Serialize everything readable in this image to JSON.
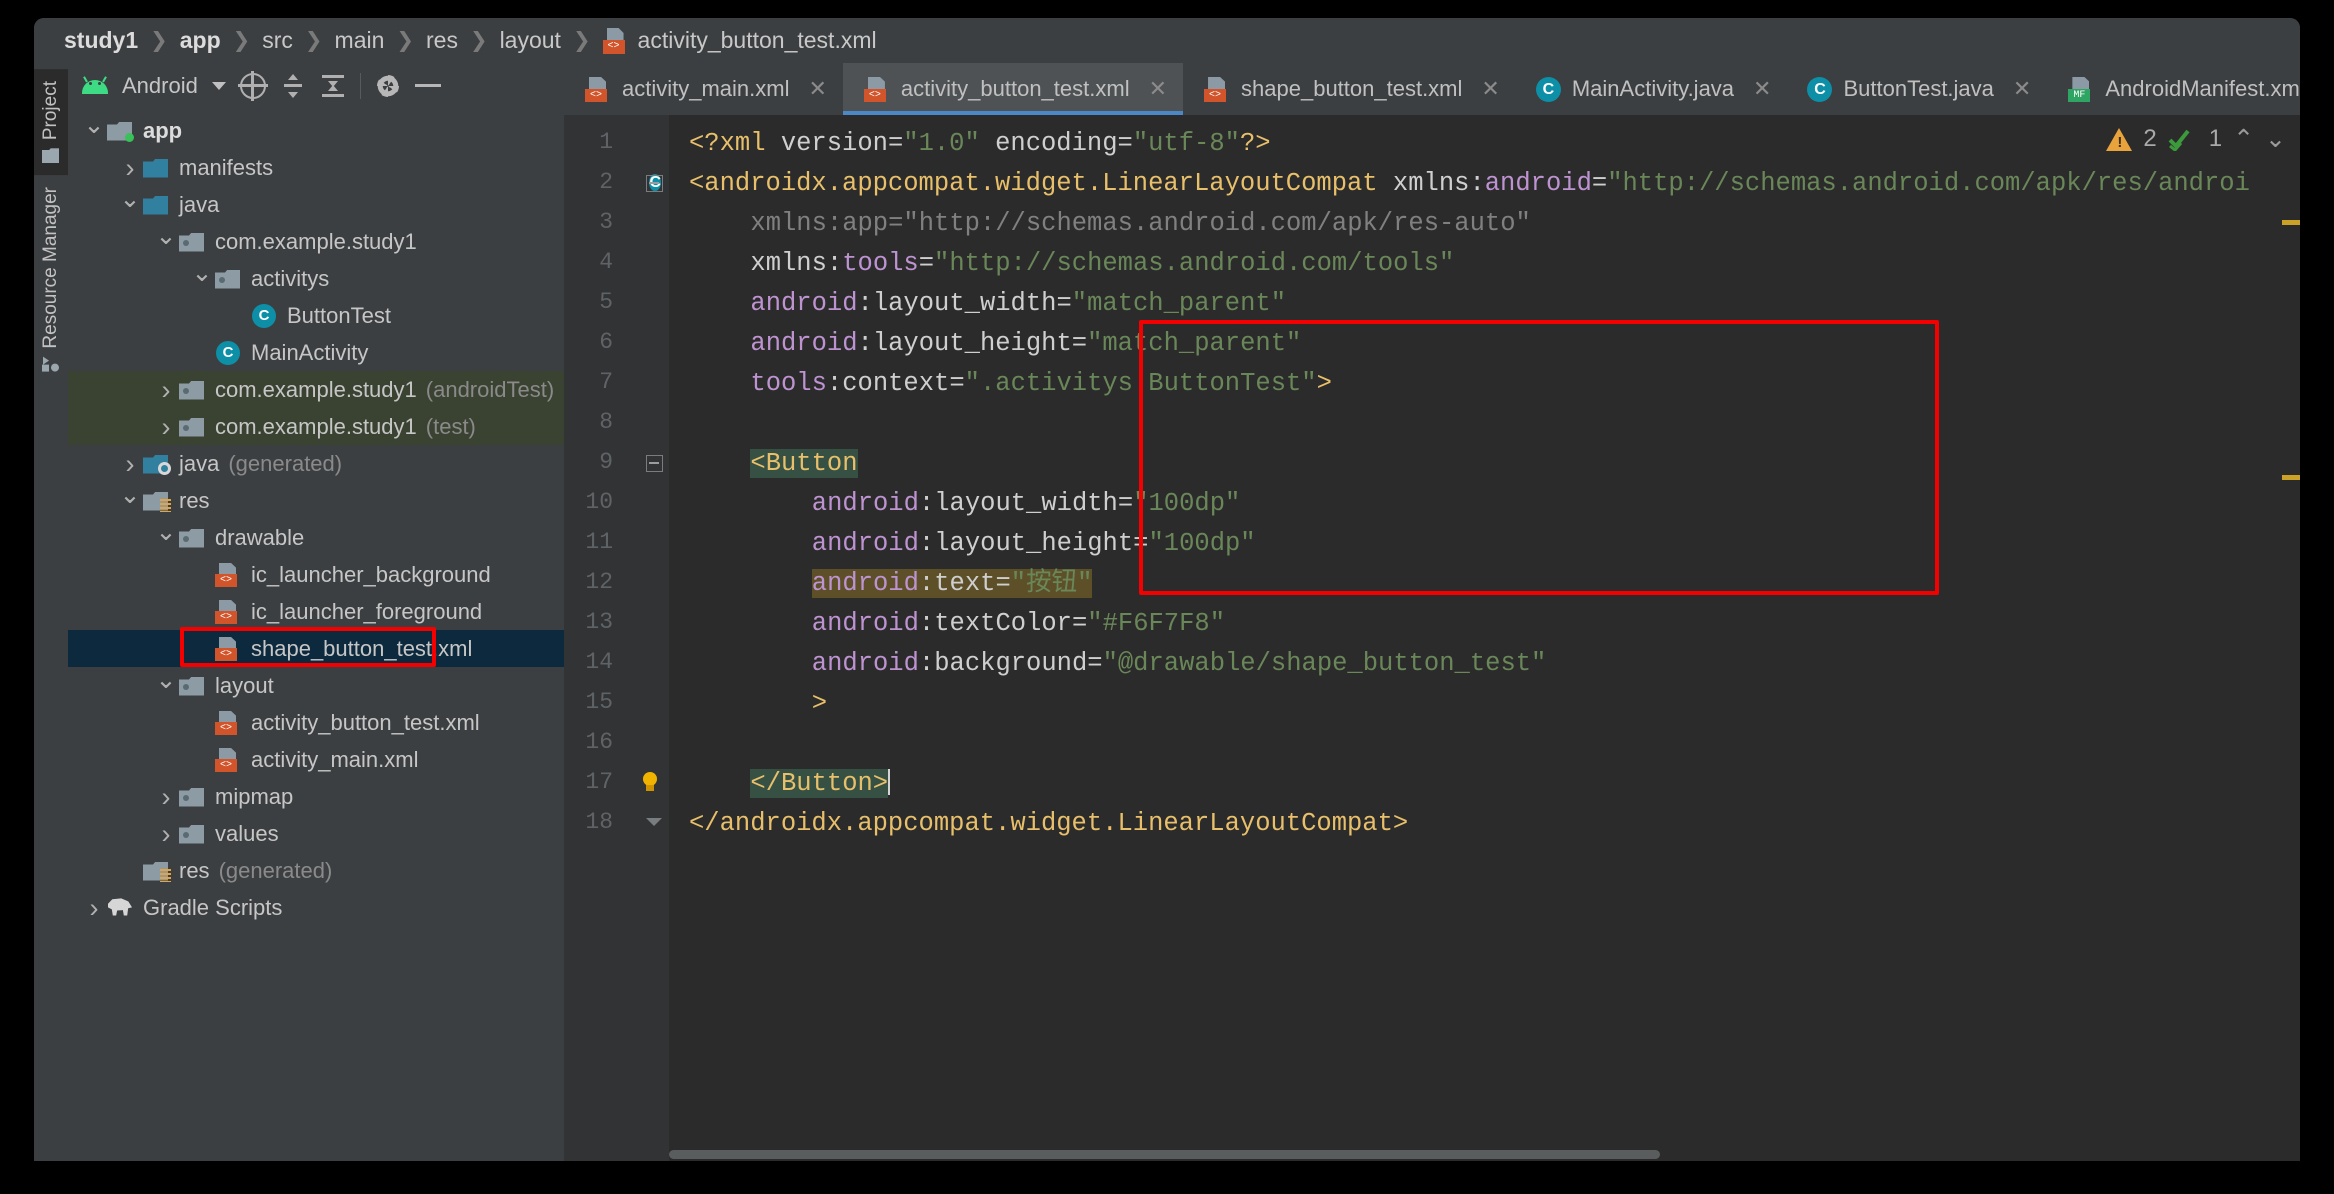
{
  "breadcrumb": {
    "items": [
      "study1",
      "app",
      "src",
      "main",
      "res",
      "layout"
    ],
    "file": "activity_button_test.xml"
  },
  "rail": {
    "project_label": "Project",
    "resource_manager_label": "Resource Manager"
  },
  "project_panel": {
    "title": "Android",
    "toolbar": [
      "select-opened-file-icon",
      "expand-all-icon",
      "collapse-all-icon",
      "settings-icon",
      "hide-icon"
    ],
    "tree": [
      {
        "label": "app",
        "depth": 0,
        "arrow": "down",
        "icon": "folder-module",
        "bold": true
      },
      {
        "label": "manifests",
        "depth": 1,
        "arrow": "right",
        "icon": "folder-blue"
      },
      {
        "label": "java",
        "depth": 1,
        "arrow": "down",
        "icon": "folder-blue"
      },
      {
        "label": "com.example.study1",
        "depth": 2,
        "arrow": "down",
        "icon": "folder-package"
      },
      {
        "label": "activitys",
        "depth": 3,
        "arrow": "down",
        "icon": "folder-package"
      },
      {
        "label": "ButtonTest",
        "depth": 4,
        "arrow": "none",
        "icon": "java-class"
      },
      {
        "label": "MainActivity",
        "depth": 3,
        "arrow": "none",
        "icon": "java-class"
      },
      {
        "label": "com.example.study1",
        "suffix": "(androidTest)",
        "depth": 2,
        "arrow": "right",
        "icon": "folder-package",
        "highlight": "green"
      },
      {
        "label": "com.example.study1",
        "suffix": "(test)",
        "depth": 2,
        "arrow": "right",
        "icon": "folder-package",
        "highlight": "green"
      },
      {
        "label": "java",
        "suffix": "(generated)",
        "depth": 1,
        "arrow": "right",
        "icon": "folder-generated"
      },
      {
        "label": "res",
        "depth": 1,
        "arrow": "down",
        "icon": "folder-res"
      },
      {
        "label": "drawable",
        "depth": 2,
        "arrow": "down",
        "icon": "folder-package"
      },
      {
        "label": "ic_launcher_background",
        "depth": 3,
        "arrow": "none",
        "icon": "xml-file"
      },
      {
        "label": "ic_launcher_foreground",
        "depth": 3,
        "arrow": "none",
        "icon": "xml-file"
      },
      {
        "label": "shape_button_test.xml",
        "depth": 3,
        "arrow": "none",
        "icon": "xml-file",
        "highlight": "blue",
        "annotated": true
      },
      {
        "label": "layout",
        "depth": 2,
        "arrow": "down",
        "icon": "folder-package"
      },
      {
        "label": "activity_button_test.xml",
        "depth": 3,
        "arrow": "none",
        "icon": "xml-file"
      },
      {
        "label": "activity_main.xml",
        "depth": 3,
        "arrow": "none",
        "icon": "xml-file"
      },
      {
        "label": "mipmap",
        "depth": 2,
        "arrow": "right",
        "icon": "folder-package"
      },
      {
        "label": "values",
        "depth": 2,
        "arrow": "right",
        "icon": "folder-package"
      },
      {
        "label": "res",
        "suffix": "(generated)",
        "depth": 1,
        "arrow": "none",
        "icon": "folder-res"
      },
      {
        "label": "Gradle Scripts",
        "depth": 0,
        "arrow": "right-small",
        "icon": "gradle"
      }
    ]
  },
  "editor_tabs": [
    {
      "label": "activity_main.xml",
      "icon": "xml-file",
      "active": false,
      "closable": true
    },
    {
      "label": "activity_button_test.xml",
      "icon": "xml-file",
      "active": true,
      "closable": true
    },
    {
      "label": "shape_button_test.xml",
      "icon": "xml-file",
      "active": false,
      "closable": true
    },
    {
      "label": "MainActivity.java",
      "icon": "java-class",
      "active": false,
      "closable": true
    },
    {
      "label": "ButtonTest.java",
      "icon": "java-class",
      "active": false,
      "closable": true
    },
    {
      "label": "AndroidManifest.xml",
      "icon": "manifest-file",
      "active": false,
      "closable": false
    }
  ],
  "inspections": {
    "warning_count": "2",
    "check_count": "1",
    "prev_label": "^",
    "next_label": "⌄"
  },
  "code": {
    "lines": [
      {
        "n": "1",
        "segments": [
          {
            "t": "<?xml ",
            "c": "k-tag"
          },
          {
            "t": "version",
            "c": "k-white"
          },
          {
            "t": "=",
            "c": "k-white"
          },
          {
            "t": "\"1.0\"",
            "c": "k-str"
          },
          {
            "t": " encoding",
            "c": "k-white"
          },
          {
            "t": "=",
            "c": "k-white"
          },
          {
            "t": "\"utf-8\"",
            "c": "k-str"
          },
          {
            "t": "?>",
            "c": "k-tag"
          }
        ]
      },
      {
        "n": "2",
        "gmark": "java-class",
        "fold": "start",
        "segments": [
          {
            "t": "<androidx.appcompat.widget.LinearLayoutCompat ",
            "c": "k-tag"
          },
          {
            "t": "xmlns",
            "c": "k-white"
          },
          {
            "t": ":",
            "c": "k-white"
          },
          {
            "t": "android",
            "c": "k-attr"
          },
          {
            "t": "=",
            "c": "k-white"
          },
          {
            "t": "\"http://schemas.android.com/apk/res/androi",
            "c": "k-str"
          }
        ]
      },
      {
        "n": "3",
        "indent": 4,
        "segments": [
          {
            "t": "xmlns:app=\"http://schemas.android.com/apk/res-auto\"",
            "c": "k-dim"
          }
        ]
      },
      {
        "n": "4",
        "indent": 4,
        "segments": [
          {
            "t": "xmlns",
            "c": "k-white"
          },
          {
            "t": ":",
            "c": "k-white"
          },
          {
            "t": "tools",
            "c": "k-attr"
          },
          {
            "t": "=",
            "c": "k-white"
          },
          {
            "t": "\"http://schemas.android.com/tools\"",
            "c": "k-str"
          }
        ]
      },
      {
        "n": "5",
        "indent": 4,
        "segments": [
          {
            "t": "android",
            "c": "k-attr"
          },
          {
            "t": ":",
            "c": "k-white"
          },
          {
            "t": "layout_width",
            "c": "k-white"
          },
          {
            "t": "=",
            "c": "k-white"
          },
          {
            "t": "\"match_parent\"",
            "c": "k-str"
          }
        ]
      },
      {
        "n": "6",
        "indent": 4,
        "segments": [
          {
            "t": "android",
            "c": "k-attr"
          },
          {
            "t": ":",
            "c": "k-white"
          },
          {
            "t": "layout_height",
            "c": "k-white"
          },
          {
            "t": "=",
            "c": "k-white"
          },
          {
            "t": "\"match_parent\"",
            "c": "k-str"
          }
        ]
      },
      {
        "n": "7",
        "indent": 4,
        "segments": [
          {
            "t": "tools",
            "c": "k-attr"
          },
          {
            "t": ":",
            "c": "k-white"
          },
          {
            "t": "context",
            "c": "k-white"
          },
          {
            "t": "=",
            "c": "k-white"
          },
          {
            "t": "\".activitys.ButtonTest\"",
            "c": "k-str"
          },
          {
            "t": ">",
            "c": "k-tag"
          }
        ]
      },
      {
        "n": "8",
        "segments": []
      },
      {
        "n": "9",
        "indent": 4,
        "fold": "start",
        "segments": [
          {
            "t": "<Button",
            "c": "k-tag hl-tag"
          }
        ]
      },
      {
        "n": "10",
        "indent": 8,
        "segments": [
          {
            "t": "android",
            "c": "k-attr"
          },
          {
            "t": ":",
            "c": "k-white"
          },
          {
            "t": "layout_width",
            "c": "k-white"
          },
          {
            "t": "=",
            "c": "k-white"
          },
          {
            "t": "\"100dp\"",
            "c": "k-str"
          }
        ]
      },
      {
        "n": "11",
        "indent": 8,
        "segments": [
          {
            "t": "android",
            "c": "k-attr"
          },
          {
            "t": ":",
            "c": "k-white"
          },
          {
            "t": "layout_height",
            "c": "k-white"
          },
          {
            "t": "=",
            "c": "k-white"
          },
          {
            "t": "\"100dp\"",
            "c": "k-str"
          }
        ]
      },
      {
        "n": "12",
        "indent": 8,
        "segments": [
          {
            "t": "android",
            "c": "k-attr hl-attr"
          },
          {
            "t": ":",
            "c": "k-white hl-attr"
          },
          {
            "t": "text",
            "c": "k-white hl-attr"
          },
          {
            "t": "=",
            "c": "k-white hl-attr"
          },
          {
            "t": "\"按钮\"",
            "c": "k-str hl-attr"
          }
        ]
      },
      {
        "n": "13",
        "indent": 8,
        "segments": [
          {
            "t": "android",
            "c": "k-attr"
          },
          {
            "t": ":",
            "c": "k-white"
          },
          {
            "t": "textColor",
            "c": "k-white"
          },
          {
            "t": "=",
            "c": "k-white"
          },
          {
            "t": "\"#F6F7F8\"",
            "c": "k-str"
          }
        ]
      },
      {
        "n": "14",
        "indent": 8,
        "segments": [
          {
            "t": "android",
            "c": "k-attr"
          },
          {
            "t": ":",
            "c": "k-white"
          },
          {
            "t": "background",
            "c": "k-white"
          },
          {
            "t": "=",
            "c": "k-white"
          },
          {
            "t": "\"@drawable/shape_button_test\"",
            "c": "k-str"
          }
        ]
      },
      {
        "n": "15",
        "indent": 8,
        "segments": [
          {
            "t": ">",
            "c": "k-tag"
          }
        ]
      },
      {
        "n": "16",
        "segments": []
      },
      {
        "n": "17",
        "indent": 4,
        "bulb": true,
        "segments": [
          {
            "t": "</Button>",
            "c": "k-tag hl-tag"
          }
        ],
        "caret": true
      },
      {
        "n": "18",
        "fold": "end",
        "segments": [
          {
            "t": "</androidx.appcompat.widget.LinearLayoutCompat>",
            "c": "k-tag"
          }
        ]
      }
    ]
  },
  "annotations": {
    "sidebar_box_label": "highlight-shape-button-test-xml",
    "code_box_label": "highlight-button-block",
    "box_color": "#f40000"
  }
}
